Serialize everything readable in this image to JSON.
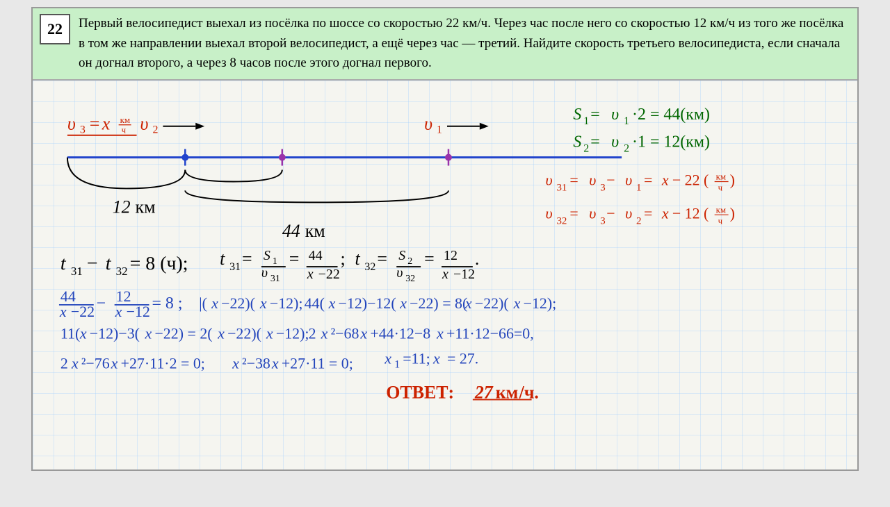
{
  "problem": {
    "number": "22",
    "text": "Первый велосипедист выехал из посёлка по шоссе со скоростью 22 км/ч. Через час после него со скоростью 12 км/ч из того же посёлка в том же направлении выехал второй велосипедист, а ещё через час — третий. Найдите скорость третьего велосипедиста, если сначала он догнал второго, а через 8 часов после этого догнал первого."
  },
  "solution": {
    "answer": "27 км/ч"
  }
}
